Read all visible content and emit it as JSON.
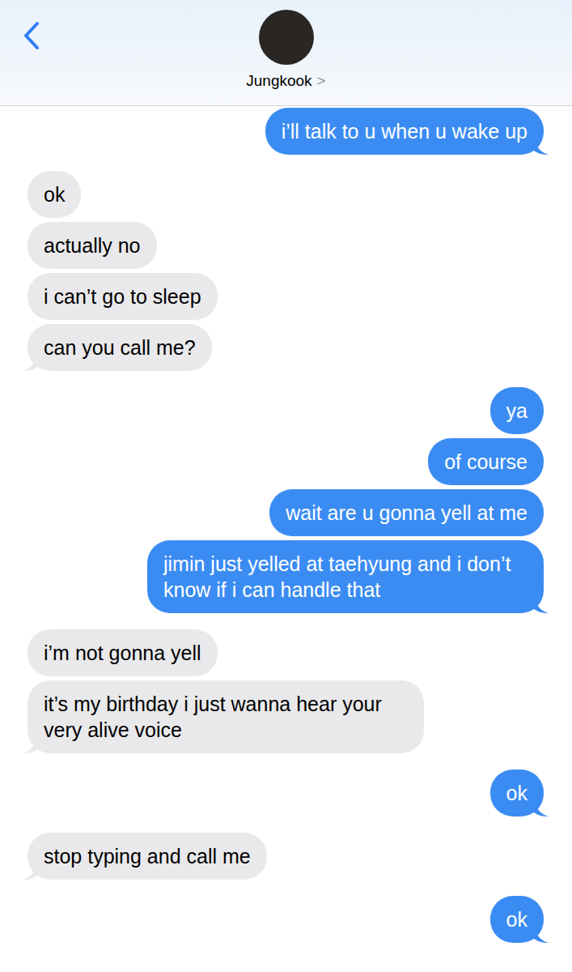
{
  "header": {
    "contact_name": "Jungkook",
    "name_chevron": ">"
  },
  "messages": [
    {
      "text": "i’ll talk to u when u wake up",
      "kind": "sent",
      "tail": true
    },
    {
      "text": "ok",
      "kind": "received",
      "tail": false
    },
    {
      "text": "actually no",
      "kind": "received",
      "tail": false
    },
    {
      "text": "i can’t go to sleep",
      "kind": "received",
      "tail": false
    },
    {
      "text": "can you call me?",
      "kind": "received",
      "tail": true
    },
    {
      "text": "ya",
      "kind": "sent",
      "tail": false
    },
    {
      "text": "of course",
      "kind": "sent",
      "tail": false
    },
    {
      "text": "wait are u gonna yell at me",
      "kind": "sent",
      "tail": false
    },
    {
      "text": "jimin just yelled at taehyung and i don’t know if i can handle that",
      "kind": "sent",
      "tail": true
    },
    {
      "text": "i’m not gonna yell",
      "kind": "received",
      "tail": false
    },
    {
      "text": "it’s my birthday i just wanna hear your very alive voice",
      "kind": "received",
      "tail": true
    },
    {
      "text": "ok",
      "kind": "sent",
      "tail": true
    },
    {
      "text": "stop typing and call me",
      "kind": "received",
      "tail": true
    },
    {
      "text": "ok",
      "kind": "sent",
      "tail": true
    }
  ]
}
